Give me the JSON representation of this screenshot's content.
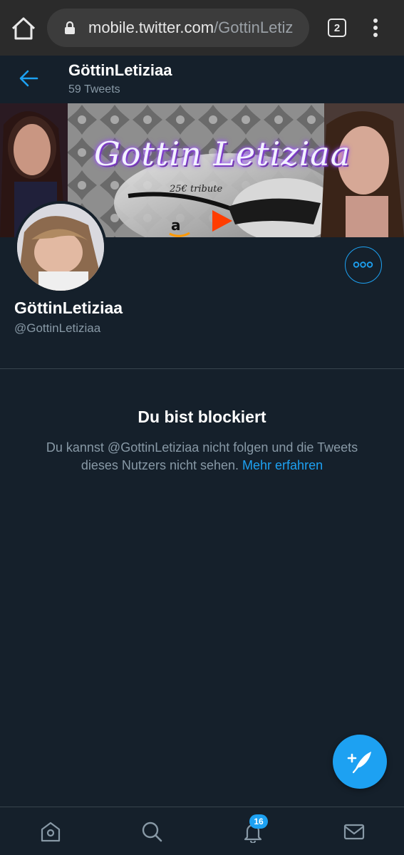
{
  "browser": {
    "url_host": "mobile.twitter.com",
    "url_path": "/GottinLetiz",
    "tab_count": "2"
  },
  "header": {
    "name": "GöttinLetiziaa",
    "tweet_count": "59 Tweets"
  },
  "banner": {
    "title": "Gottin Letiziaa",
    "subtitle": "25€ tribute"
  },
  "profile": {
    "display_name": "GöttinLetiziaa",
    "handle": "@GottinLetiziaa"
  },
  "blocked": {
    "title": "Du bist blockiert",
    "message": "Du kannst @GottinLetiziaa nicht folgen und die Tweets dieses Nutzers nicht sehen.",
    "link": "Mehr erfahren"
  },
  "bottom_nav": {
    "notifications_badge": "16",
    "items": [
      "home-icon",
      "search-icon",
      "bell-icon",
      "mail-icon"
    ]
  },
  "colors": {
    "background": "#15202b",
    "accent": "#1da1f2",
    "secondary_text": "#8899a6",
    "border": "#38444d"
  }
}
